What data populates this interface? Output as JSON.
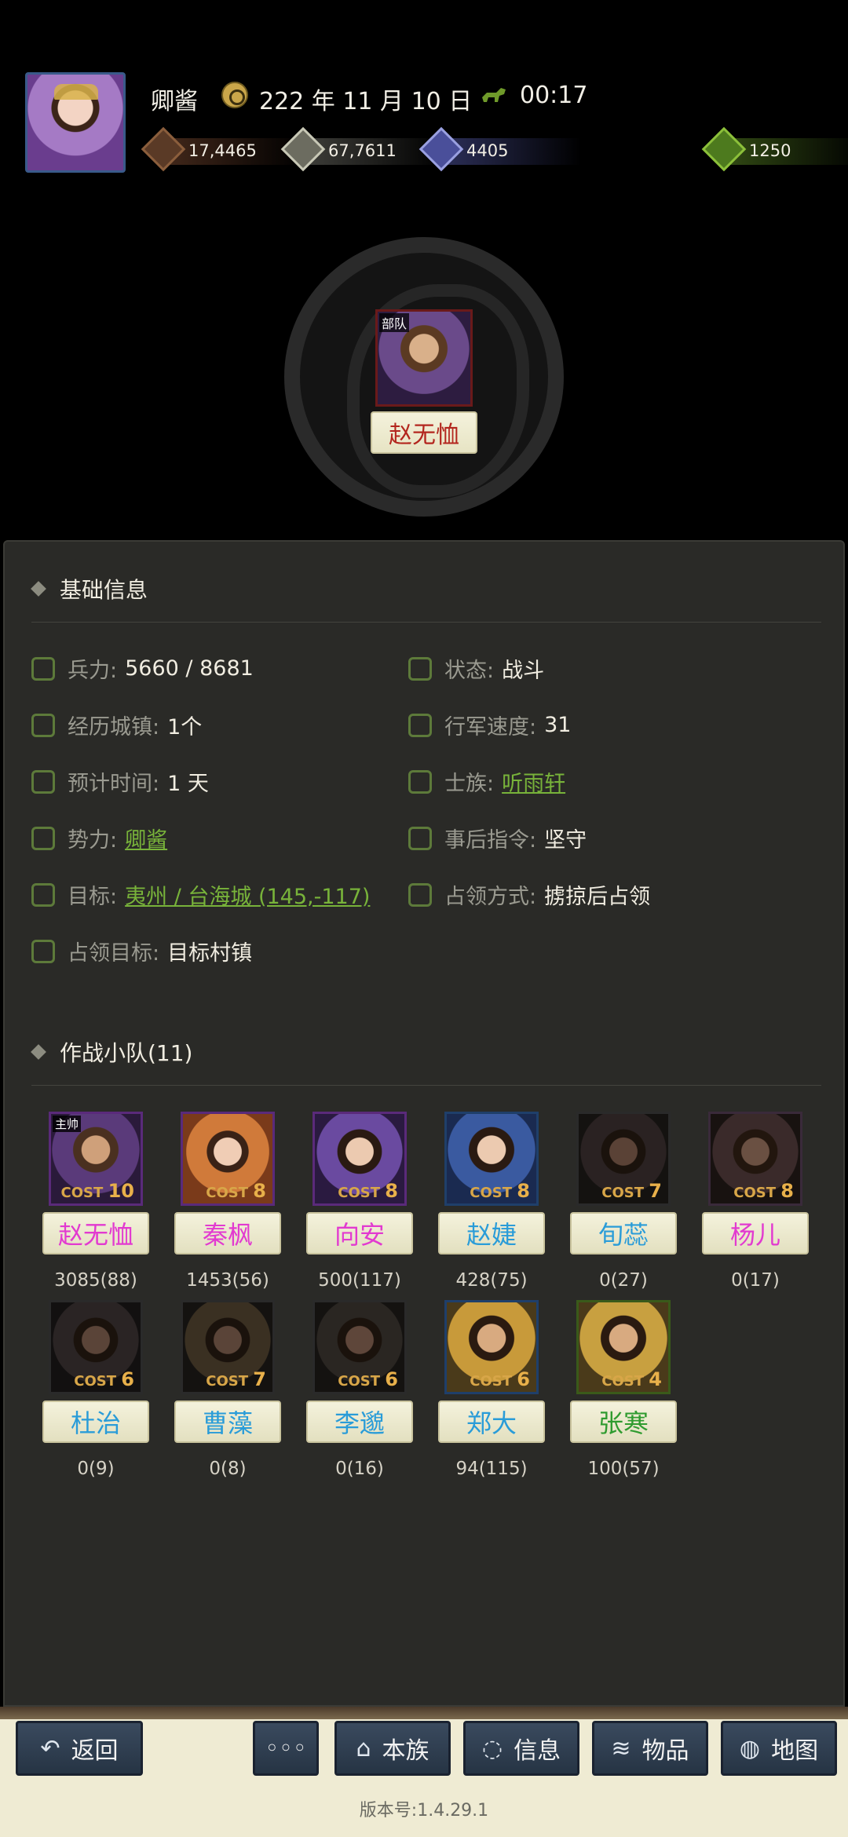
{
  "header": {
    "user_name": "卿酱",
    "date": "222 年 11 月 10 日",
    "time": "00:17",
    "resources": [
      {
        "name": "money-icon",
        "value": "17,4465"
      },
      {
        "name": "grain-icon",
        "value": "67,7611"
      },
      {
        "name": "soldier-icon",
        "value": "4405"
      },
      {
        "name": "gem-icon",
        "value": "1250"
      }
    ]
  },
  "troop": {
    "tag": "部队",
    "name": "赵无恤"
  },
  "basic_info": {
    "title": "基础信息",
    "fields": {
      "troops_label": "兵力:",
      "troops_value": "5660 / 8681",
      "status_label": "状态:",
      "status_value": "战斗",
      "towns_label": "经历城镇:",
      "towns_value": "1个",
      "speed_label": "行军速度:",
      "speed_value": "31",
      "eta_label": "预计时间:",
      "eta_value": "1 天",
      "clan_label": "士族:",
      "clan_value": "听雨轩",
      "faction_label": "势力:",
      "faction_value": "卿酱",
      "after_label": "事后指令:",
      "after_value": "坚守",
      "target_label": "目标:",
      "target_value": "夷州 / 台海城 (145,-117)",
      "occupy_mode_label": "占领方式:",
      "occupy_mode_value": "掳掠后占领",
      "occupy_target_label": "占领目标:",
      "occupy_target_value": "目标村镇"
    }
  },
  "squad": {
    "title": "作战小队(11)",
    "leader_tag": "主帅",
    "cost_label": "COST",
    "members": [
      {
        "name": "赵无恤",
        "cost": "10",
        "count": "3085(88)"
      },
      {
        "name": "秦枫",
        "cost": "8",
        "count": "1453(56)"
      },
      {
        "name": "向安",
        "cost": "8",
        "count": "500(117)"
      },
      {
        "name": "赵婕",
        "cost": "8",
        "count": "428(75)"
      },
      {
        "name": "旬蕊",
        "cost": "7",
        "count": "0(27)"
      },
      {
        "name": "杨儿",
        "cost": "8",
        "count": "0(17)"
      },
      {
        "name": "杜治",
        "cost": "6",
        "count": "0(9)"
      },
      {
        "name": "曹藻",
        "cost": "7",
        "count": "0(8)"
      },
      {
        "name": "李邈",
        "cost": "6",
        "count": "0(16)"
      },
      {
        "name": "郑大",
        "cost": "6",
        "count": "94(115)"
      },
      {
        "name": "张寒",
        "cost": "4",
        "count": "100(57)"
      }
    ]
  },
  "bottom_nav": {
    "back": "返回",
    "more": "◦◦◦",
    "clan": "本族",
    "info": "信息",
    "items": "物品",
    "map": "地图"
  },
  "version": "版本号:1.4.29.1",
  "colors": {
    "link_green": "#78b33a",
    "name_pink": "#e23ad0",
    "name_blue": "#2a9cd8",
    "name_green": "#2f9b2f",
    "troop_name_red": "#b3261e"
  }
}
